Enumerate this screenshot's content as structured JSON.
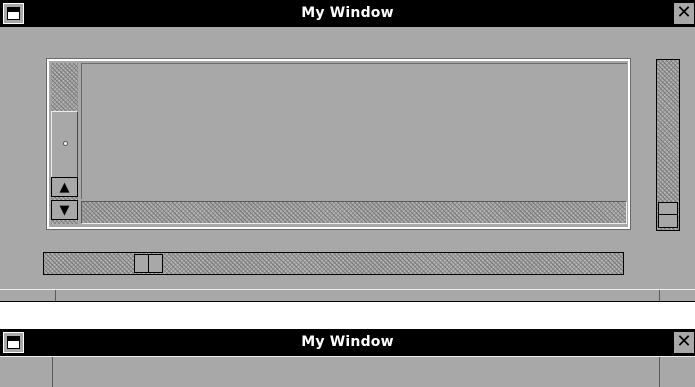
{
  "windows": [
    {
      "title": "My Window",
      "icons": {
        "menu": "window-menu-icon",
        "close": "close-x-icon"
      },
      "scrolled_window": {
        "vertical_scrollbar": {
          "up_arrow": "▲",
          "down_arrow": "▼"
        }
      }
    },
    {
      "title": "My Window",
      "icons": {
        "menu": "window-menu-icon",
        "close": "close-x-icon"
      }
    }
  ],
  "colors": {
    "titlebar_bg": "#000000",
    "titlebar_text": "#ffffff",
    "window_bg": "#a8a8a8"
  }
}
